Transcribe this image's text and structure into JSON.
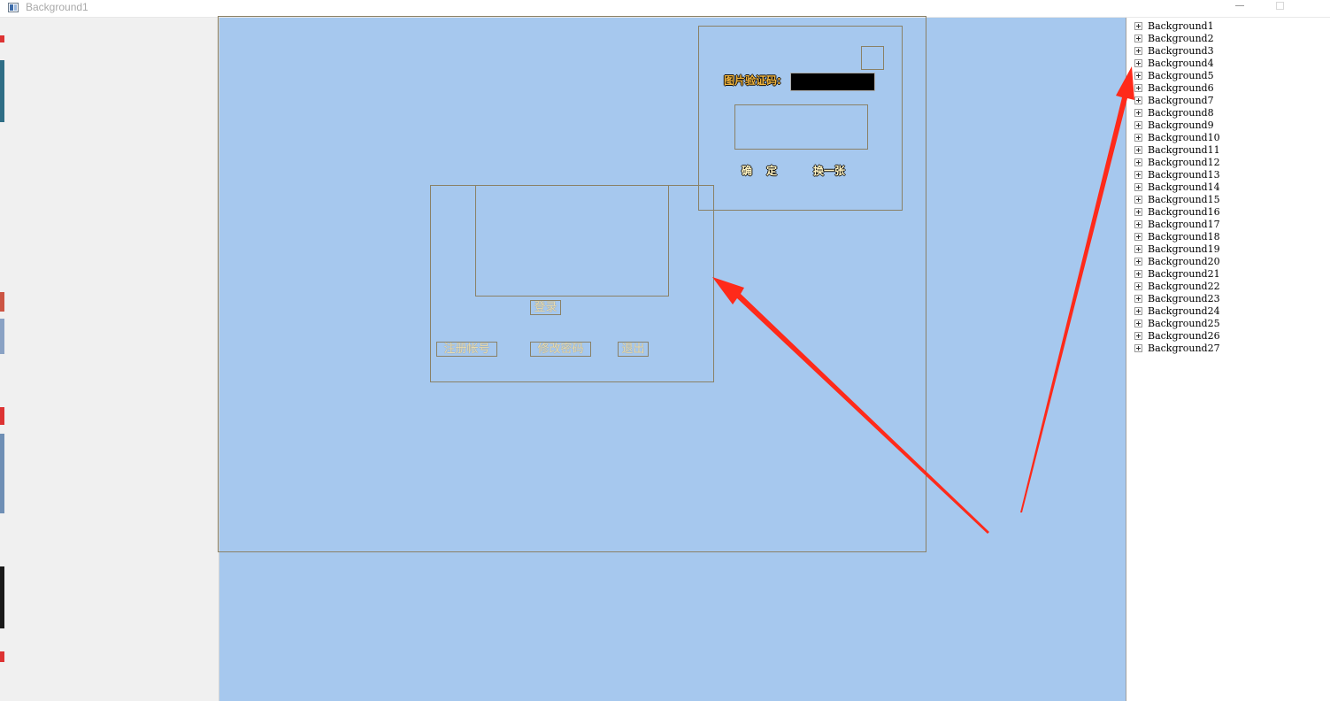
{
  "window": {
    "title": "Background1",
    "minimize_symbol": "minimize-glyph",
    "maximize_symbol": "maximize-glyph"
  },
  "colors": {
    "canvas": "#a6c8ee",
    "frame_line": "#8a8166",
    "arrow": "#ff2a1a",
    "captcha_label": "#f1b43c"
  },
  "login_panel": {
    "login_label": "登录",
    "register_label": "注册帐号",
    "change_password_label": "修改密码",
    "exit_label": "退出"
  },
  "captcha_panel": {
    "label": "图片验证码:",
    "input_value": "",
    "confirm_label": "确 定",
    "refresh_label": "换一张"
  },
  "tree": {
    "items": [
      "Background1",
      "Background2",
      "Background3",
      "Background4",
      "Background5",
      "Background6",
      "Background7",
      "Background8",
      "Background9",
      "Background10",
      "Background11",
      "Background12",
      "Background13",
      "Background14",
      "Background15",
      "Background16",
      "Background17",
      "Background18",
      "Background19",
      "Background20",
      "Background21",
      "Background22",
      "Background23",
      "Background24",
      "Background25",
      "Background26",
      "Background27"
    ]
  }
}
